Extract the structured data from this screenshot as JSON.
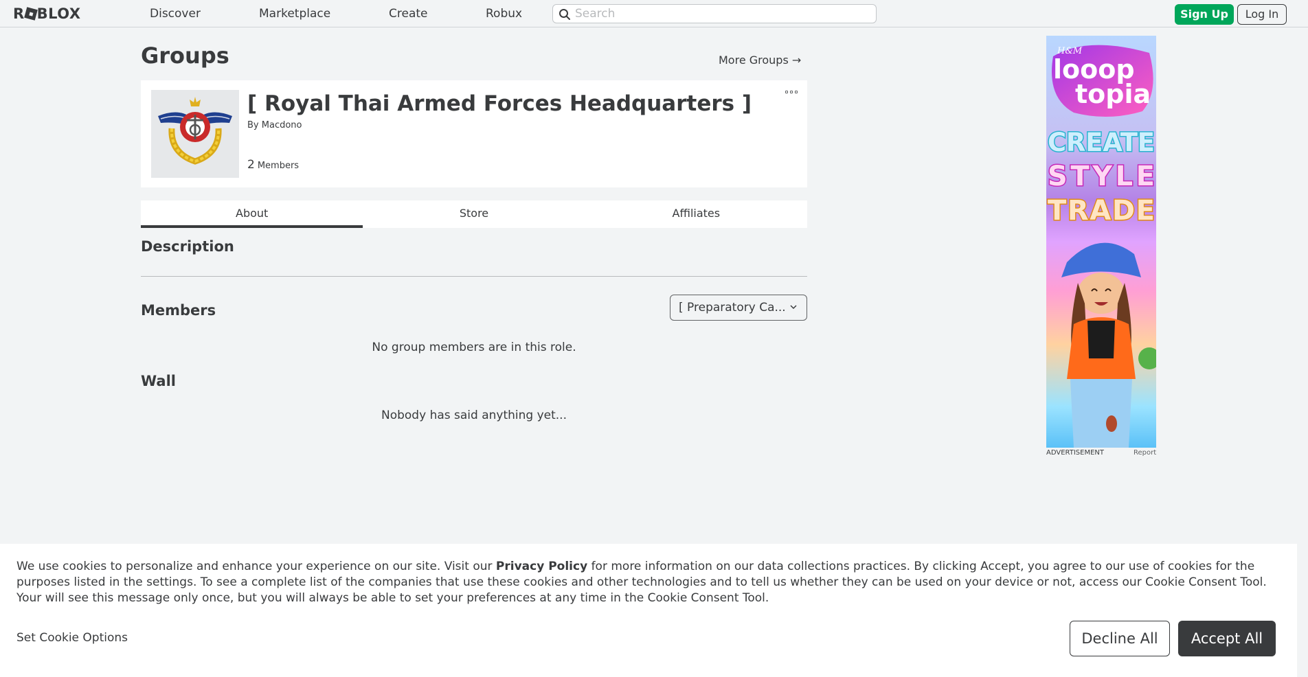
{
  "nav": {
    "logo_text": "ROBLOX",
    "links": [
      "Discover",
      "Marketplace",
      "Create",
      "Robux"
    ],
    "search_placeholder": "Search",
    "signup_label": "Sign Up",
    "login_label": "Log In"
  },
  "page": {
    "title": "Groups",
    "more_groups_label": "More Groups →"
  },
  "group": {
    "name": "[ Royal Thai Armed Forces Headquarters ]",
    "by_label": "By",
    "owner": "Macdono",
    "member_count": "2",
    "members_label": "Members"
  },
  "tabs": [
    {
      "label": "About",
      "active": true
    },
    {
      "label": "Store",
      "active": false
    },
    {
      "label": "Affiliates",
      "active": false
    }
  ],
  "sections": {
    "description_title": "Description",
    "members_title": "Members",
    "role_selected": "[ Preparatory Ca...",
    "members_empty": "No group members are in this role.",
    "wall_title": "Wall",
    "wall_empty": "Nobody has said anything yet..."
  },
  "ad": {
    "label": "ADVERTISEMENT",
    "report_label": "Report",
    "brand": "H&M",
    "line1": "looop",
    "line2": "topia",
    "words": [
      "CREATE",
      "STYLE",
      "TRADE"
    ]
  },
  "cookie": {
    "text_before": "We use cookies to personalize and enhance your experience on our site. Visit our ",
    "privacy_link": "Privacy Policy",
    "text_after": " for more information on our data collections practices. By clicking Accept, you agree to our use of cookies for the purposes listed in the settings. To see a complete list of the companies that use these cookies and other technologies and to tell us whether they can be used on your device or not, access our Cookie Consent Tool. Your will see this message only once, but you will always be able to set your preferences at any time in the Cookie Consent Tool.",
    "set_options_label": "Set Cookie Options",
    "decline_label": "Decline All",
    "accept_label": "Accept All"
  }
}
